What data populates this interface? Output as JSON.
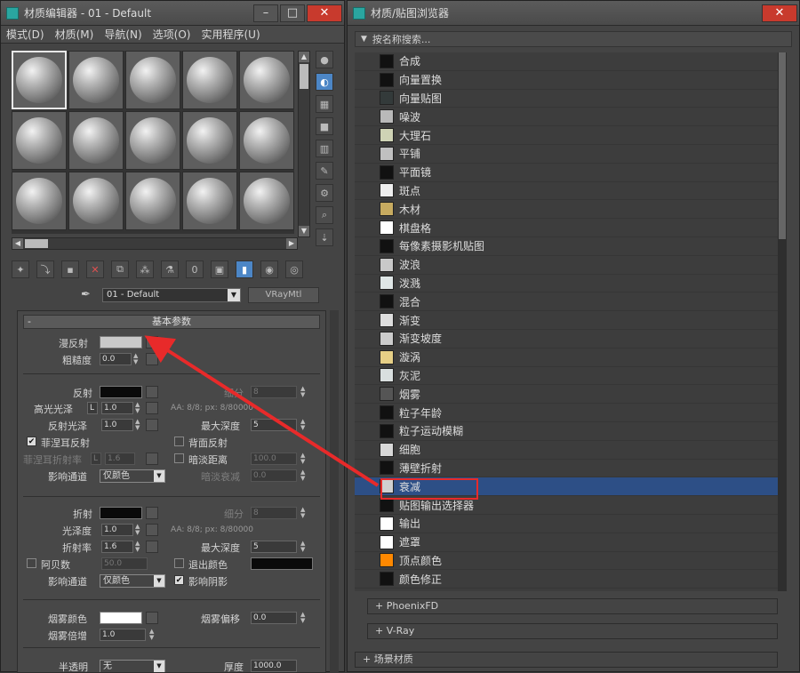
{
  "editor": {
    "title": "材质编辑器 - 01 - Default",
    "menus": [
      "模式(D)",
      "材质(M)",
      "导航(N)",
      "选项(O)",
      "实用程序(U)"
    ],
    "material_name": "01 - Default",
    "material_type": "VRayMtl",
    "rollout_title": "基本参数",
    "rollout_toggle": "-",
    "params": {
      "diffuse": "漫反射",
      "roughness": "粗糙度",
      "roughness_val": "0.0",
      "reflect": "反射",
      "hilight_gloss": "高光光泽",
      "hilight_val": "1.0",
      "lock": "L",
      "refl_gloss": "反射光泽",
      "refl_gloss_val": "1.0",
      "fresnel": "菲涅耳反射",
      "fresnel_ior": "菲涅耳折射率",
      "fresnel_ior_val": "1.6",
      "affect_ch": "影响通道",
      "affect_ch_val": "仅颜色",
      "subdivs": "细分",
      "subdivs_val": "8",
      "aa_info": "AA: 8/8; px: 8/80000",
      "max_depth": "最大深度",
      "max_depth_val": "5",
      "back_refl": "背面反射",
      "dim_dist": "暗淡距离",
      "dim_dist_val": "100.0",
      "dim_falloff": "暗淡衰减",
      "dim_falloff_val": "0.0",
      "refract": "折射",
      "gloss": "光泽度",
      "gloss_val": "1.0",
      "ior": "折射率",
      "ior_val": "1.6",
      "subdivs2_val": "8",
      "aa_info2": "AA: 8/8; px: 8/80000",
      "max_depth2_val": "5",
      "abbe": "阿贝数",
      "abbe_val": "50.0",
      "exit_color": "退出颜色",
      "affect_ch2_val": "仅颜色",
      "affect_shadow": "影响阴影",
      "fog_color": "烟雾颜色",
      "fog_bias": "烟雾偏移",
      "fog_bias_val": "0.0",
      "fog_mult": "烟雾倍增",
      "fog_mult_val": "1.0",
      "translucency": "半透明",
      "translucency_val": "无",
      "thickness": "厚度",
      "thickness_val": "1000.0"
    }
  },
  "browser": {
    "title": "材质/贴图浏览器",
    "search_placeholder": "按名称搜索...",
    "items": [
      {
        "label": "合成",
        "color": "#111111"
      },
      {
        "label": "向量置换",
        "color": "#111111"
      },
      {
        "label": "向量贴图",
        "color": "#333a3a"
      },
      {
        "label": "噪波",
        "color": "#b9b9b9"
      },
      {
        "label": "大理石",
        "color": "#cfd3b5"
      },
      {
        "label": "平铺",
        "color": "#c0c0c0"
      },
      {
        "label": "平面镜",
        "color": "#111111"
      },
      {
        "label": "斑点",
        "color": "#eeeeee"
      },
      {
        "label": "木材",
        "color": "#c7ab60"
      },
      {
        "label": "棋盘格",
        "color": "#ffffff"
      },
      {
        "label": "每像素摄影机贴图",
        "color": "#111111"
      },
      {
        "label": "波浪",
        "color": "#c9c9c9"
      },
      {
        "label": "泼溅",
        "color": "#dfe6e6"
      },
      {
        "label": "混合",
        "color": "#111111"
      },
      {
        "label": "渐变",
        "color": "#dddddd"
      },
      {
        "label": "渐变坡度",
        "color": "#cccccc"
      },
      {
        "label": "漩涡",
        "color": "#e6cf86"
      },
      {
        "label": "灰泥",
        "color": "#d9dfdf"
      },
      {
        "label": "烟雾",
        "color": "#555555"
      },
      {
        "label": "粒子年龄",
        "color": "#111111"
      },
      {
        "label": "粒子运动模糊",
        "color": "#111111"
      },
      {
        "label": "细胞",
        "color": "#d8d8d8"
      },
      {
        "label": "薄壁折射",
        "color": "#111111"
      },
      {
        "label": "衰减",
        "color": "#d0d0d0"
      },
      {
        "label": "贴图输出选择器",
        "color": "#111111"
      },
      {
        "label": "输出",
        "color": "#ffffff"
      },
      {
        "label": "遮罩",
        "color": "#ffffff"
      },
      {
        "label": "顶点颜色",
        "color": "#ff8800"
      },
      {
        "label": "颜色修正",
        "color": "#111111"
      }
    ],
    "highlight_index": 23,
    "categories": [
      "+ PhoenixFD",
      "+ V-Ray"
    ],
    "scene_materials": "+ 场景材质"
  },
  "colors": {
    "highlight": "#2d4f86",
    "callout": "#e82a2a"
  }
}
